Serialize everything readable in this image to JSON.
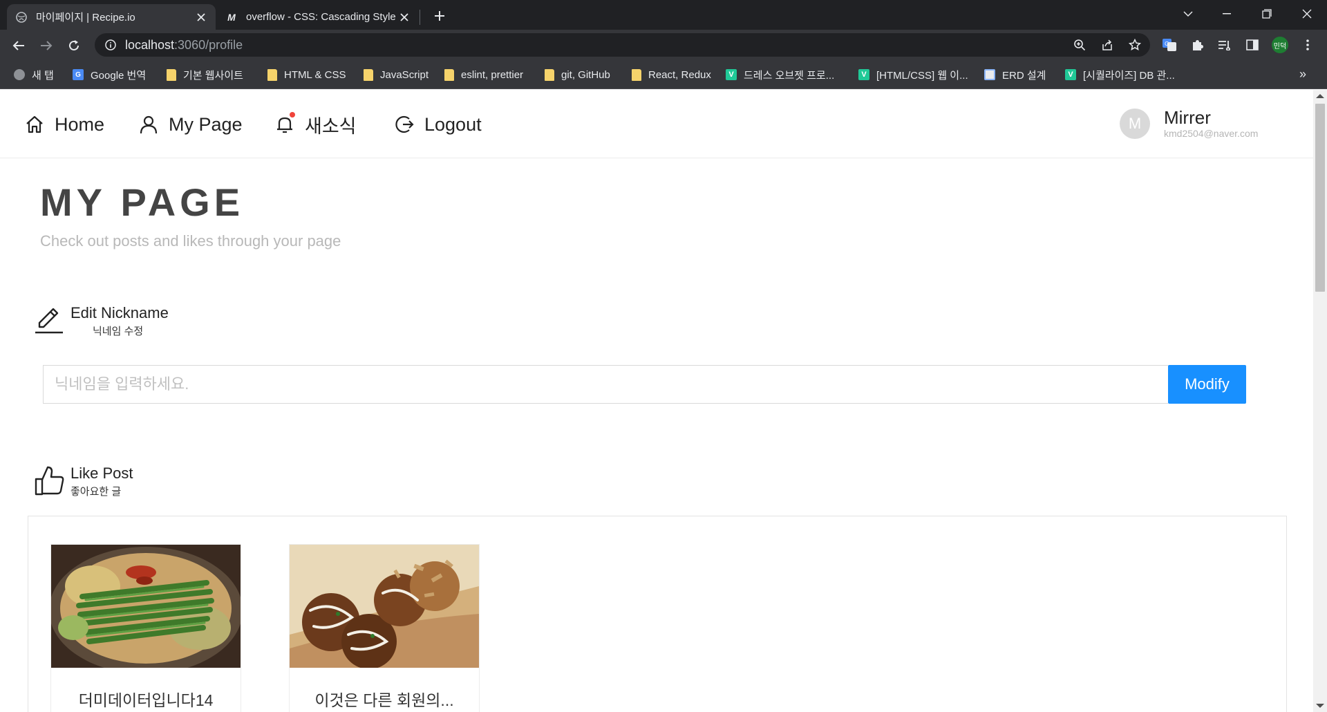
{
  "browser": {
    "tabs": [
      {
        "title": "마이페이지 | Recipe.io",
        "active": true
      },
      {
        "title": "overflow - CSS: Cascading Style",
        "active": false
      }
    ],
    "url_host": "localhost",
    "url_path": ":3060/profile",
    "profile_label": "민덕",
    "bookmarks": [
      {
        "label": "새 탭",
        "icon": "globe"
      },
      {
        "label": "Google 번역",
        "icon": "google-translate"
      },
      {
        "label": "기본 웹사이트",
        "icon": "folder"
      },
      {
        "label": "HTML & CSS",
        "icon": "folder"
      },
      {
        "label": "JavaScript",
        "icon": "folder"
      },
      {
        "label": "eslint, prettier",
        "icon": "folder"
      },
      {
        "label": "git, GitHub",
        "icon": "folder"
      },
      {
        "label": "React, Redux",
        "icon": "folder"
      },
      {
        "label": "드레스 오브젯 프로...",
        "icon": "velog"
      },
      {
        "label": "[HTML/CSS] 웹 이...",
        "icon": "velog"
      },
      {
        "label": "ERD 설계",
        "icon": "doc"
      },
      {
        "label": "[시퀄라이즈] DB 관...",
        "icon": "velog"
      }
    ]
  },
  "nav": {
    "home": "Home",
    "mypage": "My Page",
    "news": "새소식",
    "logout": "Logout"
  },
  "user": {
    "initial": "M",
    "name": "Mirrer",
    "email": "kmd2504@naver.com"
  },
  "page": {
    "title": "MY PAGE",
    "subtitle": "Check out posts and likes through your page"
  },
  "edit_nickname": {
    "title": "Edit Nickname",
    "subtitle": "닉네임 수정",
    "placeholder": "닉네임을 입력하세요.",
    "button": "Modify"
  },
  "like_post": {
    "title": "Like Post",
    "subtitle": "좋아요한 글",
    "cards": [
      {
        "title": "더미데이터입니다14",
        "image": "motsunabe-hotpot-photo"
      },
      {
        "title": "이것은 다른 회원의...",
        "image": "takoyaki-photo"
      }
    ]
  },
  "colors": {
    "primary": "#1890ff",
    "notification_dot": "#f0433a",
    "chrome_dark": "#202124"
  }
}
